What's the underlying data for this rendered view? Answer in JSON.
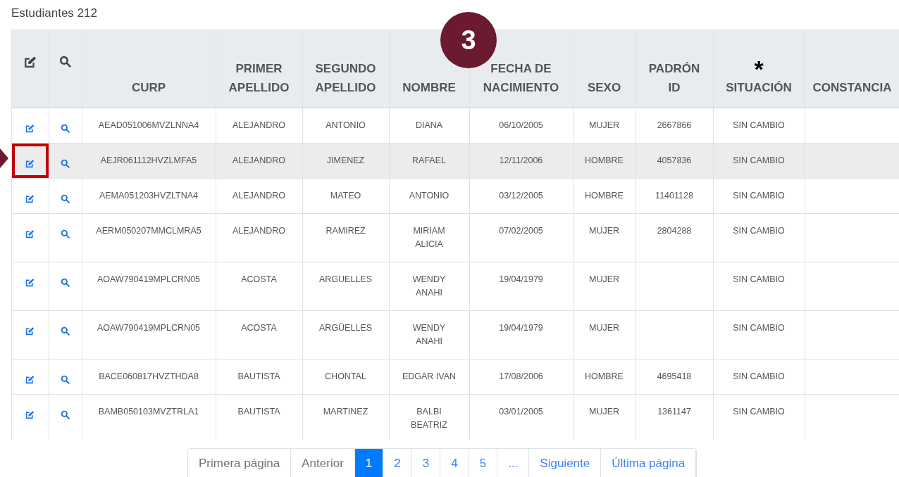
{
  "heading": "Estudiantes 212",
  "callout": "3",
  "table": {
    "actions": [
      {
        "kind": "edit"
      },
      {
        "kind": "search"
      }
    ],
    "columns": [
      {
        "kind": "text",
        "label": "CURP"
      },
      {
        "kind": "text",
        "label": "PRIMER\nAPELLIDO"
      },
      {
        "kind": "text",
        "label": "SEGUNDO\nAPELLIDO"
      },
      {
        "kind": "text",
        "label": "NOMBRE"
      },
      {
        "kind": "text",
        "label": "FECHA DE\nNACIMIENTO"
      },
      {
        "kind": "text",
        "label": "SEXO"
      },
      {
        "kind": "text",
        "label": "PADRÓN\nID"
      },
      {
        "kind": "text",
        "label": "SITUACIÓN",
        "marker": "*"
      },
      {
        "kind": "text",
        "label": "CONSTANCIA"
      }
    ],
    "rows": [
      {
        "selected": false,
        "marked": false,
        "cells": [
          "AEAD051006MVZLNNA4",
          "ALEJANDRO",
          "ANTONIO",
          "DIANA",
          "06/10/2005",
          "MUJER",
          "2667866",
          "SIN CAMBIO"
        ]
      },
      {
        "selected": true,
        "marked": true,
        "cells": [
          "AEJR061112HVZLMFA5",
          "ALEJANDRO",
          "JIMENEZ",
          "RAFAEL",
          "12/11/2006",
          "HOMBRE",
          "4057836",
          "SIN CAMBIO"
        ]
      },
      {
        "selected": false,
        "marked": false,
        "cells": [
          "AEMA051203HVZLTNA4",
          "ALEJANDRO",
          "MATEO",
          "ANTONIO",
          "03/12/2005",
          "HOMBRE",
          "11401128",
          "SIN CAMBIO"
        ]
      },
      {
        "selected": false,
        "marked": false,
        "cells": [
          "AERM050207MMCLMRA5",
          "ALEJANDRO",
          "RAMIREZ",
          "MIRIAM\nALICIA",
          "07/02/2005",
          "MUJER",
          "2804288",
          "SIN CAMBIO"
        ]
      },
      {
        "selected": false,
        "marked": false,
        "cells": [
          "AOAW790419MPLCRN05",
          "ACOSTA",
          "ARGUELLES",
          "WENDY\nANAHI",
          "19/04/1979",
          "MUJER",
          "",
          "SIN CAMBIO"
        ]
      },
      {
        "selected": false,
        "marked": false,
        "cells": [
          "AOAW790419MPLCRN05",
          "ACOSTA",
          "ARGÜELLES",
          "WENDY\nANAHI",
          "19/04/1979",
          "MUJER",
          "",
          "SIN CAMBIO"
        ]
      },
      {
        "selected": false,
        "marked": false,
        "cells": [
          "BACE060817HVZTHDA8",
          "BAUTISTA",
          "CHONTAL",
          "EDGAR IVAN",
          "17/08/2006",
          "HOMBRE",
          "4695418",
          "SIN CAMBIO"
        ]
      },
      {
        "selected": false,
        "marked": false,
        "cells": [
          "BAMB050103MVZTRLA1",
          "BAUTISTA",
          "MARTINEZ",
          "BALBI\nBEATRIZ",
          "03/01/2005",
          "MUJER",
          "1361147",
          "SIN CAMBIO"
        ]
      }
    ]
  },
  "pagination": [
    {
      "label": "Primera página",
      "selected": false,
      "disabled": true
    },
    {
      "label": "Anterior",
      "selected": false,
      "disabled": true
    },
    {
      "label": "1",
      "selected": true,
      "disabled": false
    },
    {
      "label": "2",
      "selected": false,
      "disabled": false
    },
    {
      "label": "3",
      "selected": false,
      "disabled": false
    },
    {
      "label": "4",
      "selected": false,
      "disabled": false
    },
    {
      "label": "5",
      "selected": false,
      "disabled": false
    },
    {
      "label": "...",
      "selected": false,
      "disabled": false
    },
    {
      "label": "Siguiente",
      "selected": false,
      "disabled": false
    },
    {
      "label": "Última página",
      "selected": false,
      "disabled": false
    }
  ]
}
